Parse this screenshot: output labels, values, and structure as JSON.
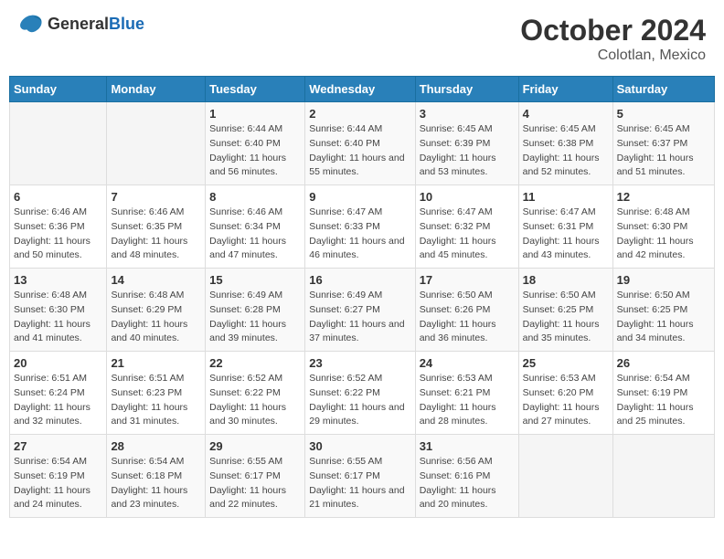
{
  "header": {
    "logo_general": "General",
    "logo_blue": "Blue",
    "month": "October 2024",
    "location": "Colotlan, Mexico"
  },
  "days_of_week": [
    "Sunday",
    "Monday",
    "Tuesday",
    "Wednesday",
    "Thursday",
    "Friday",
    "Saturday"
  ],
  "weeks": [
    [
      {
        "day": "",
        "info": ""
      },
      {
        "day": "",
        "info": ""
      },
      {
        "day": "1",
        "info": "Sunrise: 6:44 AM\nSunset: 6:40 PM\nDaylight: 11 hours and 56 minutes."
      },
      {
        "day": "2",
        "info": "Sunrise: 6:44 AM\nSunset: 6:40 PM\nDaylight: 11 hours and 55 minutes."
      },
      {
        "day": "3",
        "info": "Sunrise: 6:45 AM\nSunset: 6:39 PM\nDaylight: 11 hours and 53 minutes."
      },
      {
        "day": "4",
        "info": "Sunrise: 6:45 AM\nSunset: 6:38 PM\nDaylight: 11 hours and 52 minutes."
      },
      {
        "day": "5",
        "info": "Sunrise: 6:45 AM\nSunset: 6:37 PM\nDaylight: 11 hours and 51 minutes."
      }
    ],
    [
      {
        "day": "6",
        "info": "Sunrise: 6:46 AM\nSunset: 6:36 PM\nDaylight: 11 hours and 50 minutes."
      },
      {
        "day": "7",
        "info": "Sunrise: 6:46 AM\nSunset: 6:35 PM\nDaylight: 11 hours and 48 minutes."
      },
      {
        "day": "8",
        "info": "Sunrise: 6:46 AM\nSunset: 6:34 PM\nDaylight: 11 hours and 47 minutes."
      },
      {
        "day": "9",
        "info": "Sunrise: 6:47 AM\nSunset: 6:33 PM\nDaylight: 11 hours and 46 minutes."
      },
      {
        "day": "10",
        "info": "Sunrise: 6:47 AM\nSunset: 6:32 PM\nDaylight: 11 hours and 45 minutes."
      },
      {
        "day": "11",
        "info": "Sunrise: 6:47 AM\nSunset: 6:31 PM\nDaylight: 11 hours and 43 minutes."
      },
      {
        "day": "12",
        "info": "Sunrise: 6:48 AM\nSunset: 6:30 PM\nDaylight: 11 hours and 42 minutes."
      }
    ],
    [
      {
        "day": "13",
        "info": "Sunrise: 6:48 AM\nSunset: 6:30 PM\nDaylight: 11 hours and 41 minutes."
      },
      {
        "day": "14",
        "info": "Sunrise: 6:48 AM\nSunset: 6:29 PM\nDaylight: 11 hours and 40 minutes."
      },
      {
        "day": "15",
        "info": "Sunrise: 6:49 AM\nSunset: 6:28 PM\nDaylight: 11 hours and 39 minutes."
      },
      {
        "day": "16",
        "info": "Sunrise: 6:49 AM\nSunset: 6:27 PM\nDaylight: 11 hours and 37 minutes."
      },
      {
        "day": "17",
        "info": "Sunrise: 6:50 AM\nSunset: 6:26 PM\nDaylight: 11 hours and 36 minutes."
      },
      {
        "day": "18",
        "info": "Sunrise: 6:50 AM\nSunset: 6:25 PM\nDaylight: 11 hours and 35 minutes."
      },
      {
        "day": "19",
        "info": "Sunrise: 6:50 AM\nSunset: 6:25 PM\nDaylight: 11 hours and 34 minutes."
      }
    ],
    [
      {
        "day": "20",
        "info": "Sunrise: 6:51 AM\nSunset: 6:24 PM\nDaylight: 11 hours and 32 minutes."
      },
      {
        "day": "21",
        "info": "Sunrise: 6:51 AM\nSunset: 6:23 PM\nDaylight: 11 hours and 31 minutes."
      },
      {
        "day": "22",
        "info": "Sunrise: 6:52 AM\nSunset: 6:22 PM\nDaylight: 11 hours and 30 minutes."
      },
      {
        "day": "23",
        "info": "Sunrise: 6:52 AM\nSunset: 6:22 PM\nDaylight: 11 hours and 29 minutes."
      },
      {
        "day": "24",
        "info": "Sunrise: 6:53 AM\nSunset: 6:21 PM\nDaylight: 11 hours and 28 minutes."
      },
      {
        "day": "25",
        "info": "Sunrise: 6:53 AM\nSunset: 6:20 PM\nDaylight: 11 hours and 27 minutes."
      },
      {
        "day": "26",
        "info": "Sunrise: 6:54 AM\nSunset: 6:19 PM\nDaylight: 11 hours and 25 minutes."
      }
    ],
    [
      {
        "day": "27",
        "info": "Sunrise: 6:54 AM\nSunset: 6:19 PM\nDaylight: 11 hours and 24 minutes."
      },
      {
        "day": "28",
        "info": "Sunrise: 6:54 AM\nSunset: 6:18 PM\nDaylight: 11 hours and 23 minutes."
      },
      {
        "day": "29",
        "info": "Sunrise: 6:55 AM\nSunset: 6:17 PM\nDaylight: 11 hours and 22 minutes."
      },
      {
        "day": "30",
        "info": "Sunrise: 6:55 AM\nSunset: 6:17 PM\nDaylight: 11 hours and 21 minutes."
      },
      {
        "day": "31",
        "info": "Sunrise: 6:56 AM\nSunset: 6:16 PM\nDaylight: 11 hours and 20 minutes."
      },
      {
        "day": "",
        "info": ""
      },
      {
        "day": "",
        "info": ""
      }
    ]
  ]
}
